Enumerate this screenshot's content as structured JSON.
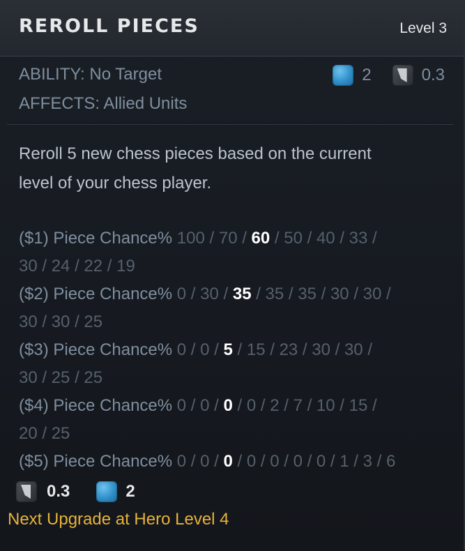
{
  "ability": {
    "title": "REROLL PIECES",
    "level": "Level 3",
    "ability_type": "ABILITY: No Target",
    "affects": "AFFECTS: Allied Units",
    "mana_cost": "2",
    "cooldown": "0.3",
    "mana_icon": "mana-icon",
    "cooldown_icon": "cooldown-icon"
  },
  "description": {
    "line1": "Reroll 5 new chess pieces based on the current",
    "line2": "level of your chess player."
  },
  "scaling": [
    {
      "label": "($1) Piece Chance%",
      "pre": " 100 / 70 / ",
      "current": "60",
      "post": " / 50 / 40 / 33 /",
      "cont": "30 / 24 / 22 / 19"
    },
    {
      "label": "($2) Piece Chance%",
      "pre": " 0 / 30 / ",
      "current": "35",
      "post": " / 35 / 35 / 30 / 30 /",
      "cont": "30 / 30 / 25"
    },
    {
      "label": "($3) Piece Chance%",
      "pre": " 0 / 0 / ",
      "current": "5",
      "post": " / 15 / 23 / 30 / 30 /",
      "cont": "30 / 25 / 25"
    },
    {
      "label": "($4) Piece Chance%",
      "pre": " 0 / 0 / ",
      "current": "0",
      "post": " / 0 / 2 / 7 / 10 / 15 /",
      "cont": "20 / 25"
    },
    {
      "label": "($5) Piece Chance%",
      "pre": " 0 / 0 / ",
      "current": "0",
      "post": " / 0 / 0 / 0 / 0 / 1 / 3 / 6",
      "cont": ""
    }
  ],
  "footer": {
    "cooldown": "0.3",
    "mana_cost": "2",
    "next_upgrade": "Next Upgrade at Hero Level 4"
  },
  "colors": {
    "accent_gold": "#e7b33a",
    "mana_blue": "#2f8fc8",
    "muted_label": "#7f8e9e",
    "muted_value": "#56606b"
  }
}
